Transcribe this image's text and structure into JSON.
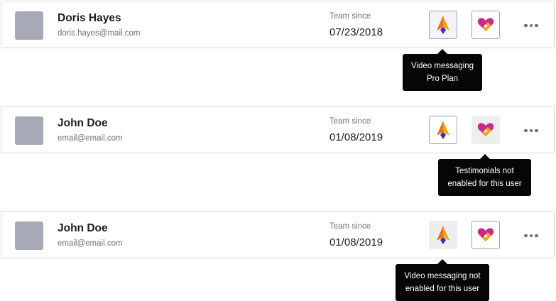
{
  "users": [
    {
      "name": "Doris Hayes",
      "email": "doris.hayes@mail.com",
      "team_since_label": "Team since",
      "team_since": "07/23/2018"
    },
    {
      "name": "John Doe",
      "email": "email@email.com",
      "team_since_label": "Team since",
      "team_since": "01/08/2019"
    },
    {
      "name": "John Doe",
      "email": "email@email.com",
      "team_since_label": "Team since",
      "team_since": "01/08/2019"
    }
  ],
  "tooltips": [
    {
      "line1": "Video messaging",
      "line2": "Pro Plan"
    },
    {
      "line1": "Testimonials not",
      "line2": "enabled for this user"
    },
    {
      "line1": "Video messaging not",
      "line2": "enabled for this user"
    }
  ],
  "icons": {
    "video": "video-messaging-app-icon",
    "testimonials": "testimonials-heart-app-icon",
    "more": "more-options-icon"
  },
  "colors": {
    "avatar_placeholder": "#a7a9b6",
    "tooltip_bg": "#060606",
    "video_icon_orange": "#f7a21b",
    "video_icon_purple": "#3e2ab3",
    "heart_magenta": "#c42b8c",
    "heart_orange": "#f7a21b"
  }
}
